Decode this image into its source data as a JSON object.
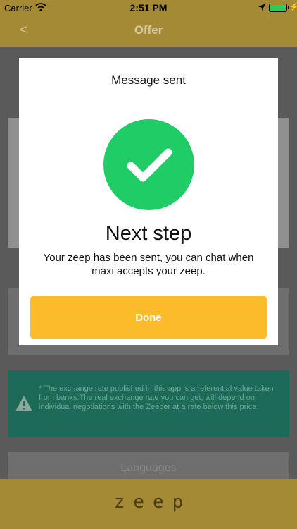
{
  "status_bar": {
    "carrier": "Carrier",
    "time": "2:51 PM"
  },
  "nav": {
    "back": "<",
    "title": "Offer"
  },
  "modal": {
    "heading": "Message sent",
    "title": "Next step",
    "description": "Your zeep has been sent, you can chat when maxi accepts your zeep.",
    "done_label": "Done"
  },
  "notice": {
    "text": "* The exchange rate published in this app is a referential value taken from banks.The real exchange rate you can get, will depend on individual negotiations with the Zeeper at a rate below this price."
  },
  "languages": {
    "label": "Languages"
  },
  "footer": {
    "logo": "zeep"
  },
  "colors": {
    "brand": "#a58a36",
    "success": "#1fcc66",
    "button": "#fbbb2a",
    "notice": "#1e6a58"
  },
  "icons": [
    "wifi-icon",
    "location-icon",
    "battery-icon",
    "checkmark-icon",
    "warning-icon"
  ]
}
